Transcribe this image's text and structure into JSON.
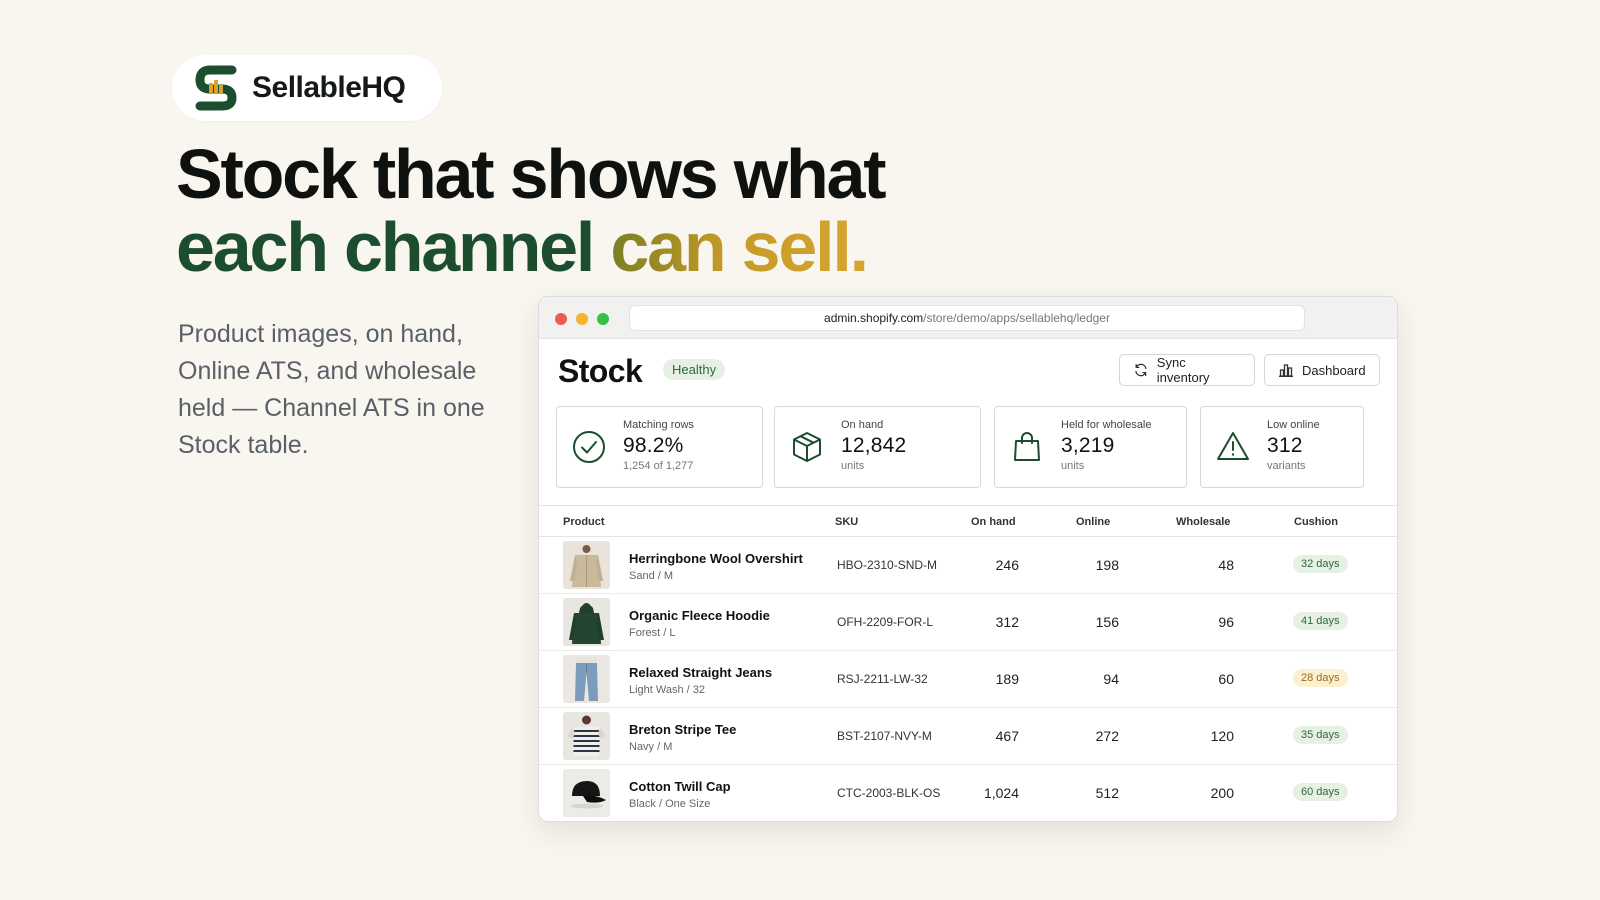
{
  "brand": {
    "name": "SellableHQ"
  },
  "headline": {
    "line1": "Stock that shows what",
    "line2_green": "each channel",
    "line2_gold": "can sell."
  },
  "subcopy": "Product images, on hand, Online ATS, and wholesale held — Channel ATS in one Stock table.",
  "browser": {
    "url_host": "admin.shopify.com",
    "url_path": "/store/demo/apps/sellablehq/ledger"
  },
  "page": {
    "title": "Stock",
    "status": "Healthy",
    "buttons": {
      "sync": "Sync inventory",
      "dashboard": "Dashboard"
    }
  },
  "kpis": [
    {
      "label": "Matching rows",
      "value": "98.2%",
      "sub": "1,254 of 1,277",
      "icon": "check-circle-icon"
    },
    {
      "label": "On hand",
      "value": "12,842",
      "sub": "units",
      "icon": "box-icon"
    },
    {
      "label": "Held for wholesale",
      "value": "3,219",
      "sub": "units",
      "icon": "shopping-bag-icon"
    },
    {
      "label": "Low online",
      "value": "312",
      "sub": "variants",
      "icon": "warning-icon"
    }
  ],
  "table": {
    "columns": [
      "Product",
      "SKU",
      "On hand",
      "Online",
      "Wholesale",
      "Cushion"
    ],
    "rows": [
      {
        "name": "Herringbone Wool Overshirt",
        "variant": "Sand / M",
        "sku": "HBO-2310-SND-M",
        "on_hand": "246",
        "online": "198",
        "wholesale": "48",
        "cushion": "32 days",
        "status": "ok"
      },
      {
        "name": "Organic Fleece Hoodie",
        "variant": "Forest / L",
        "sku": "OFH-2209-FOR-L",
        "on_hand": "312",
        "online": "156",
        "wholesale": "96",
        "cushion": "41 days",
        "status": "ok"
      },
      {
        "name": "Relaxed Straight Jeans",
        "variant": "Light Wash / 32",
        "sku": "RSJ-2211-LW-32",
        "on_hand": "189",
        "online": "94",
        "wholesale": "60",
        "cushion": "28 days",
        "status": "warn"
      },
      {
        "name": "Breton Stripe Tee",
        "variant": "Navy / M",
        "sku": "BST-2107-NVY-M",
        "on_hand": "467",
        "online": "272",
        "wholesale": "120",
        "cushion": "35 days",
        "status": "ok"
      },
      {
        "name": "Cotton Twill Cap",
        "variant": "Black / One Size",
        "sku": "CTC-2003-BLK-OS",
        "on_hand": "1,024",
        "online": "512",
        "wholesale": "200",
        "cushion": "60 days",
        "status": "ok"
      }
    ]
  },
  "colors": {
    "brand_green": "#1b4d2e",
    "brand_gold": "#d7a52e",
    "ok_badge_bg": "#e6f0e3",
    "warn_badge_bg": "#fbf0cf"
  }
}
